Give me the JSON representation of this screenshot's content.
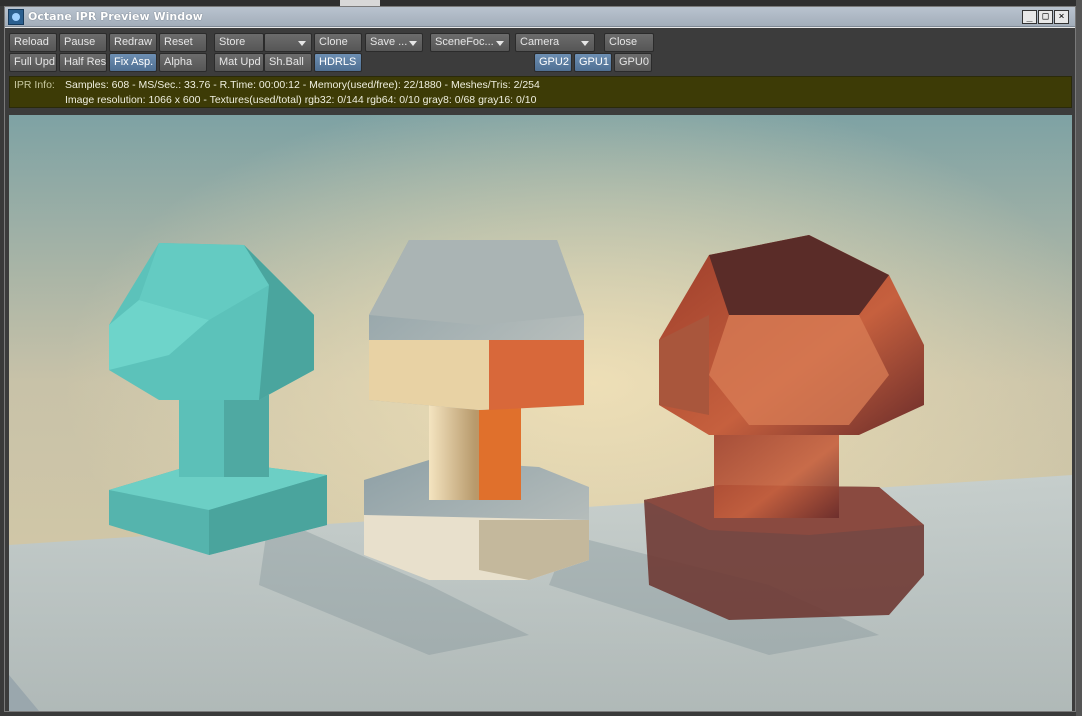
{
  "window": {
    "title": "Octane IPR Preview Window",
    "controls": {
      "minimize": "_",
      "maximize": "□",
      "close": "×"
    }
  },
  "toolbar": {
    "row1": [
      {
        "id": "reload",
        "label": "Reload"
      },
      {
        "id": "pause",
        "label": "Pause"
      },
      {
        "id": "redraw",
        "label": "Redraw"
      },
      {
        "id": "reset",
        "label": "Reset"
      },
      {
        "id": "store",
        "label": "Store"
      },
      {
        "id": "store-select",
        "label": ""
      },
      {
        "id": "clone",
        "label": "Clone"
      },
      {
        "id": "save",
        "label": "Save ..."
      },
      {
        "id": "scenefocus",
        "label": "SceneFoc..."
      },
      {
        "id": "camera",
        "label": "Camera"
      },
      {
        "id": "close",
        "label": "Close"
      }
    ],
    "row2": [
      {
        "id": "full-upd",
        "label": "Full Upd."
      },
      {
        "id": "half-res",
        "label": "Half Res"
      },
      {
        "id": "fix-asp",
        "label": "Fix Asp."
      },
      {
        "id": "alpha",
        "label": "Alpha"
      },
      {
        "id": "mat-upd",
        "label": "Mat Upd"
      },
      {
        "id": "sh-ball",
        "label": "Sh.Ball"
      },
      {
        "id": "hdrls",
        "label": "HDRLS"
      },
      {
        "id": "gpu2",
        "label": "GPU2"
      },
      {
        "id": "gpu1",
        "label": "GPU1"
      },
      {
        "id": "gpu0",
        "label": "GPU0"
      }
    ],
    "active": [
      "fix-asp",
      "hdrls",
      "gpu2",
      "gpu1"
    ]
  },
  "ipr_info": {
    "label": "IPR Info:",
    "line1": "Samples: 608  -  MS/Sec.: 33.76  -  R.Time: 00:00:12 - Memory(used/free): 22/1880  -  Meshes/Tris: 2/254",
    "line2": "Image resolution: 1066 x 600 - Textures(used/total) rgb32: 0/144   rgb64: 0/10   gray8: 0/68   gray16: 0/10"
  },
  "colors": {
    "toolbar_active": "#5d7fa3",
    "info_bg": "#3d3b06",
    "teal_object": "#5cc0b8",
    "chrome_object": "#d8c8a8",
    "glass_object": "#8a3a2a"
  }
}
